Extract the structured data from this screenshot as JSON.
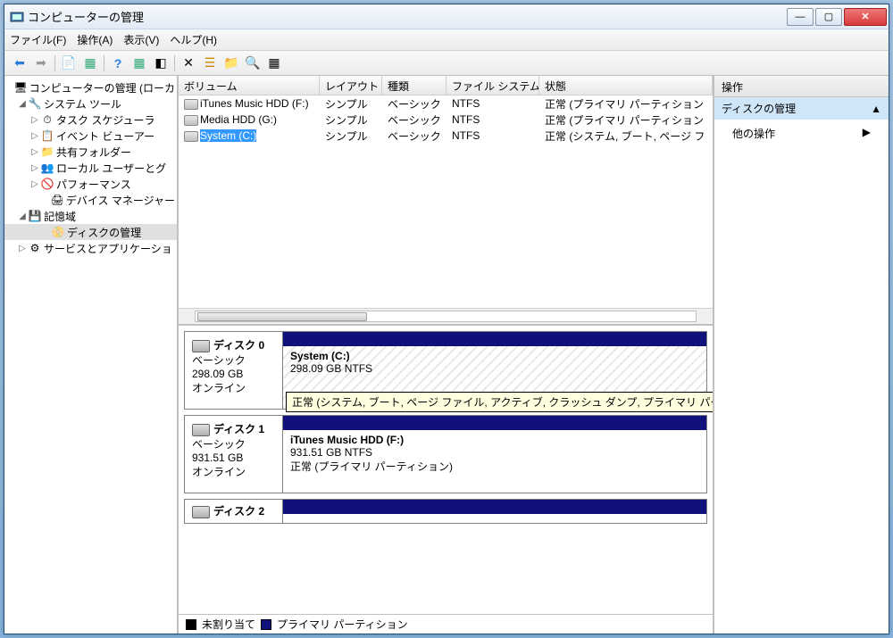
{
  "window": {
    "title": "コンピューターの管理"
  },
  "menu": {
    "file": "ファイル(F)",
    "action": "操作(A)",
    "view": "表示(V)",
    "help": "ヘルプ(H)"
  },
  "tree": {
    "root": "コンピューターの管理 (ローカ",
    "systools": "システム ツール",
    "task": "タスク スケジューラ",
    "event": "イベント ビューアー",
    "shared": "共有フォルダー",
    "users": "ローカル ユーザーとグ",
    "perf": "パフォーマンス",
    "devmgr": "デバイス マネージャー",
    "storage": "記憶域",
    "diskmgmt": "ディスクの管理",
    "services": "サービスとアプリケーショ"
  },
  "volcols": {
    "volume": "ボリューム",
    "layout": "レイアウト",
    "type": "種類",
    "fs": "ファイル システム",
    "status": "状態"
  },
  "vols": [
    {
      "name": "iTunes Music HDD (F:)",
      "layout": "シンプル",
      "type": "ベーシック",
      "fs": "NTFS",
      "status": "正常 (プライマリ パーティション"
    },
    {
      "name": "Media HDD (G:)",
      "layout": "シンプル",
      "type": "ベーシック",
      "fs": "NTFS",
      "status": "正常 (プライマリ パーティション"
    },
    {
      "name": "System (C:)",
      "layout": "シンプル",
      "type": "ベーシック",
      "fs": "NTFS",
      "status": "正常 (システム, ブート, ページ フ",
      "selected": true
    }
  ],
  "disks": [
    {
      "name": "ディスク 0",
      "kind": "ベーシック",
      "size": "298.09 GB",
      "state": "オンライン",
      "part": {
        "name": "System  (C:)",
        "info": "298.09 GB NTFS"
      },
      "tooltip": "正常 (システム, ブート, ページ ファイル, アクティブ, クラッシュ ダンプ, プライマリ パーティション)",
      "hatched": true
    },
    {
      "name": "ディスク 1",
      "kind": "ベーシック",
      "size": "931.51 GB",
      "state": "オンライン",
      "part": {
        "name": "iTunes Music HDD  (F:)",
        "info": "931.51 GB NTFS",
        "status": "正常 (プライマリ パーティション)"
      }
    },
    {
      "name": "ディスク 2"
    }
  ],
  "legend": {
    "unalloc": "未割り当て",
    "primary": "プライマリ パーティション"
  },
  "actions": {
    "header": "操作",
    "selected": "ディスクの管理",
    "other": "他の操作"
  }
}
